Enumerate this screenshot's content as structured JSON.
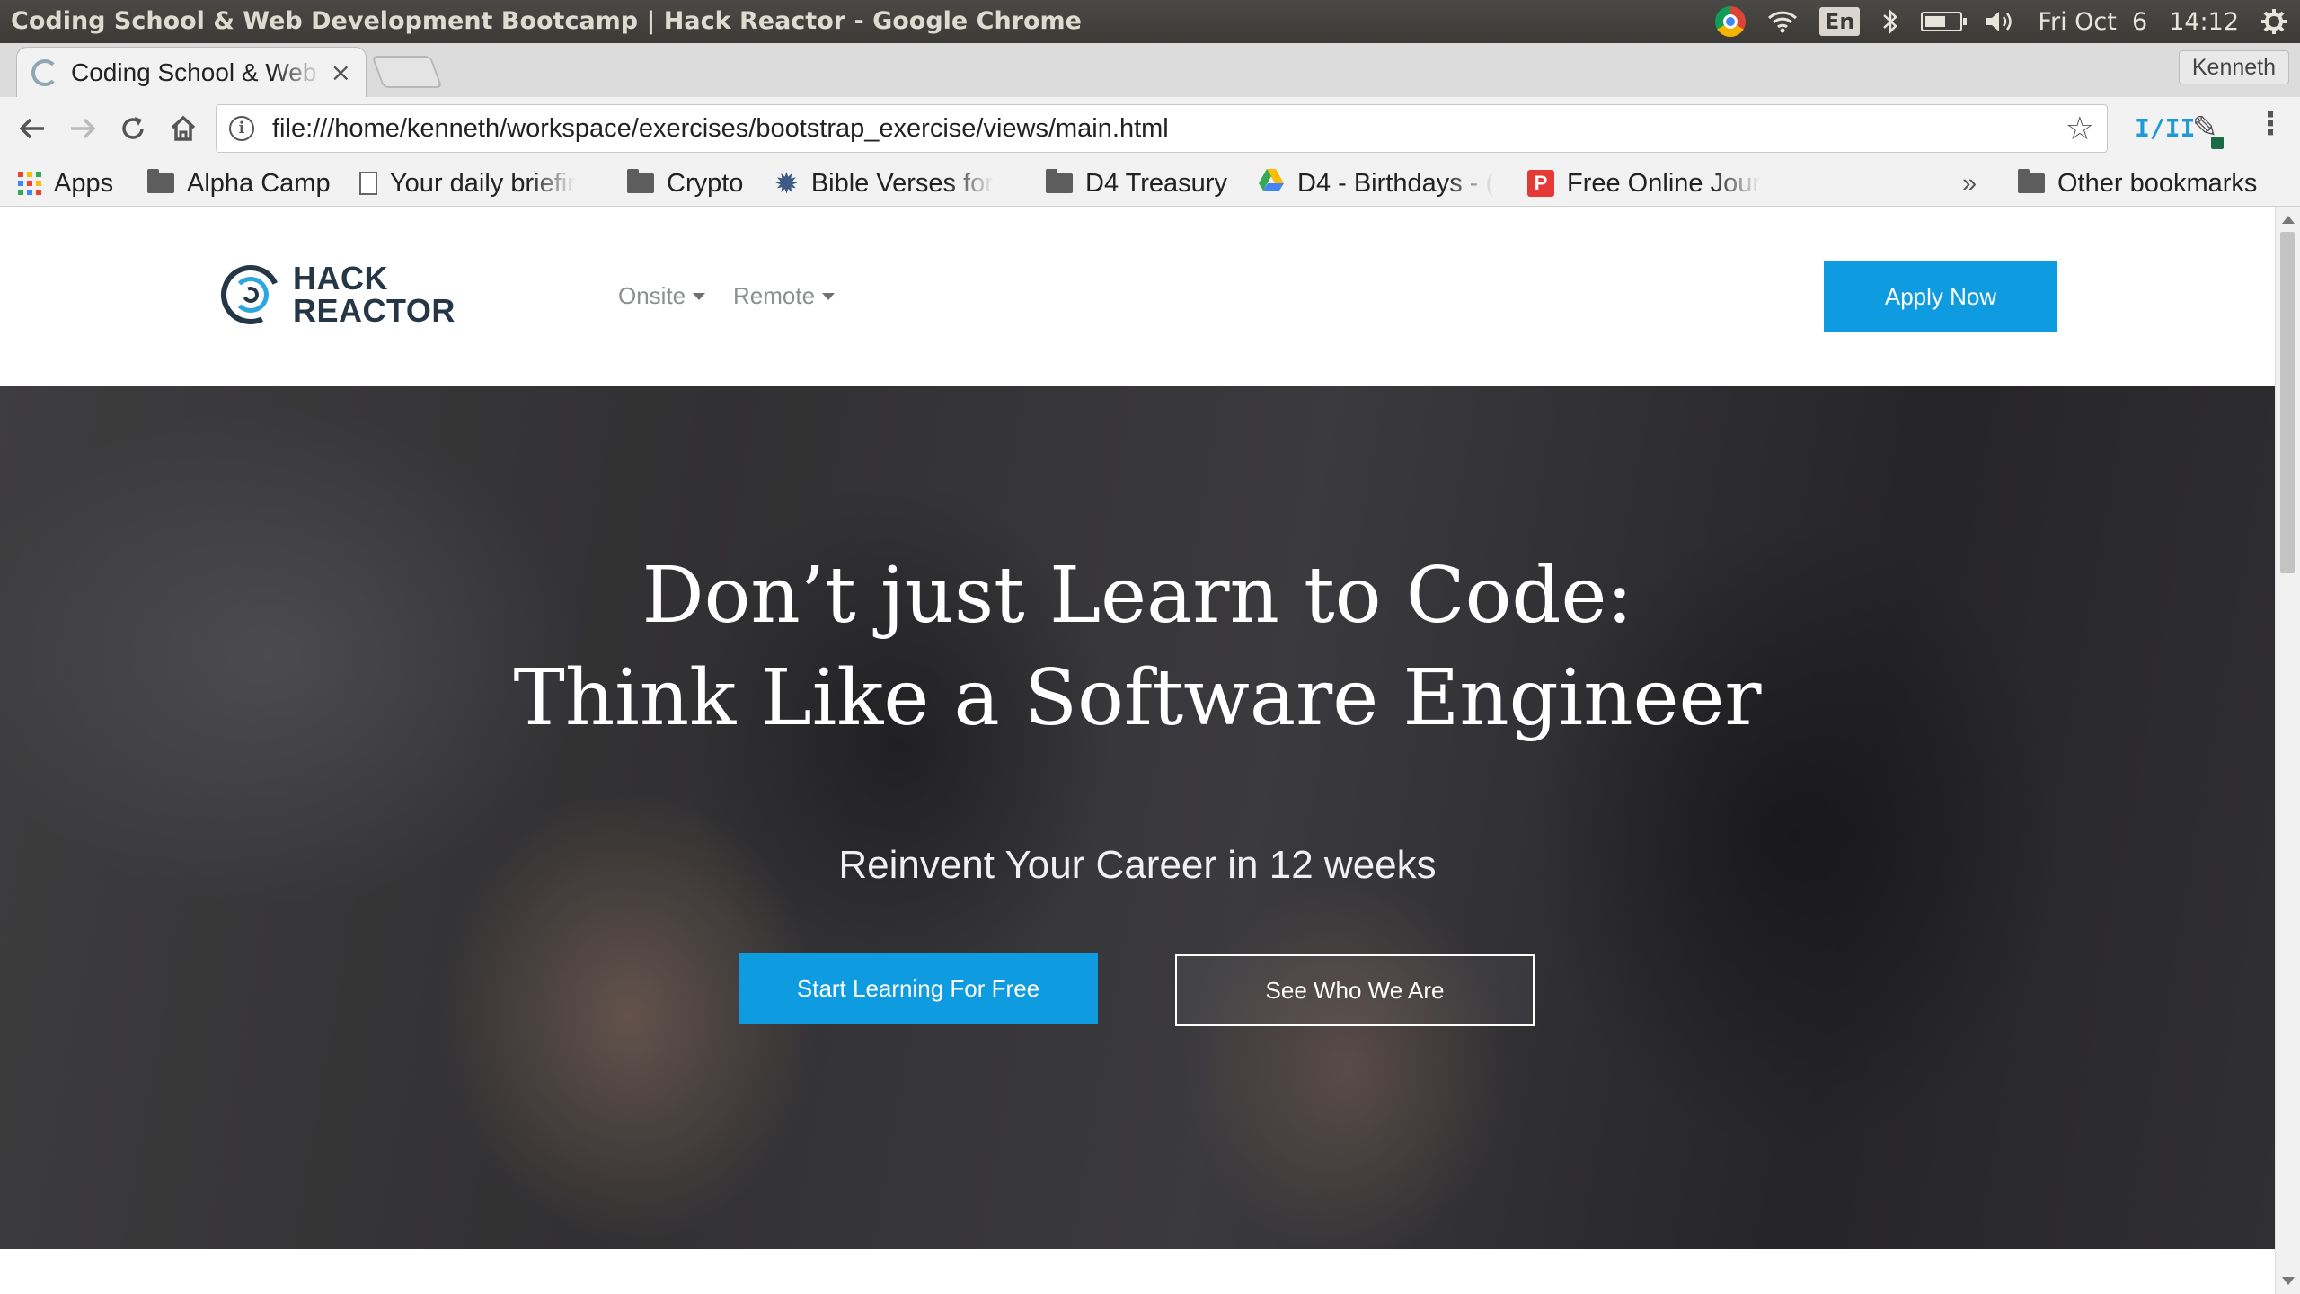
{
  "os": {
    "window_title": "Coding School & Web Development Bootcamp | Hack Reactor - Google Chrome",
    "language": "En",
    "date": "Fri Oct  6",
    "time": "14:12",
    "battery_level": 0.6
  },
  "browser": {
    "tab_title": "Coding School & Web Development Bootcamp | Hack Reactor",
    "tab_close": "×",
    "profile_name": "Kenneth",
    "url": "file:///home/kenneth/workspace/exercises/bootstrap_exercise/views/main.html",
    "extension_label": "I/II",
    "bookmarks": {
      "apps": "Apps",
      "alpha_camp": "Alpha Camp",
      "daily_briefing": "Your daily briefir",
      "crypto": "Crypto",
      "bible_verses": "Bible Verses for",
      "d4_treasury": "D4 Treasury",
      "d4_birthdays": "D4 - Birthdays - (",
      "free_online": "Free Online Jour",
      "overflow": "»",
      "other": "Other bookmarks"
    }
  },
  "site": {
    "logo_line1": "HACK",
    "logo_line2": "REACTOR",
    "nav_onsite": "Onsite",
    "nav_remote": "Remote",
    "apply_button": "Apply Now",
    "hero_title_line1": "Don’t just Learn to Code:",
    "hero_title_line2": "Think Like a Software Engineer",
    "hero_subtitle": "Reinvent Your Career in 12 weeks",
    "cta_primary": "Start Learning For Free",
    "cta_secondary": "See Who We Are"
  },
  "colors": {
    "brand_blue": "#0f9be0",
    "logo_dark": "#253746"
  }
}
